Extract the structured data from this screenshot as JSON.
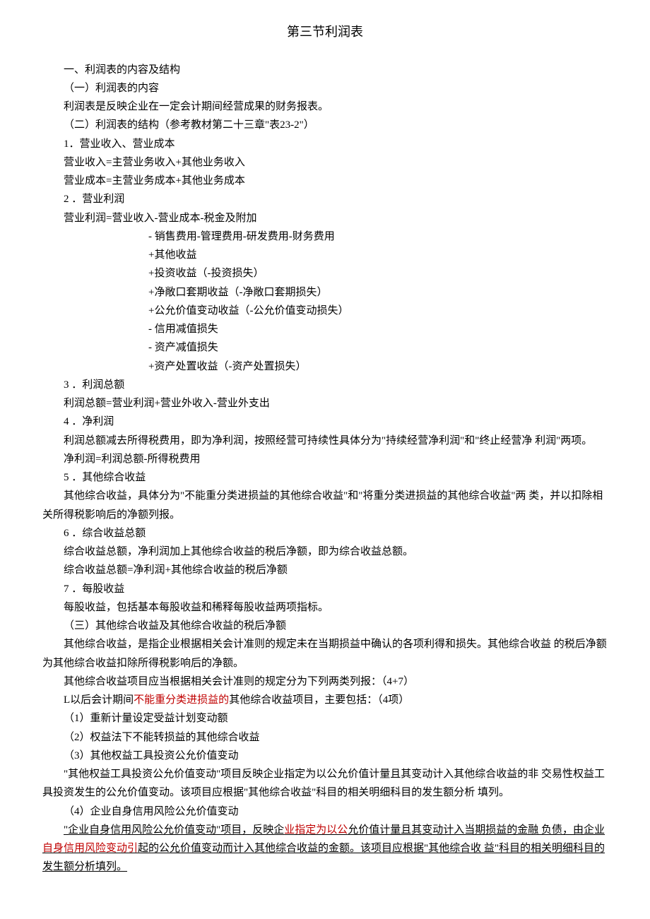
{
  "title": "第三节利润表",
  "lines": {
    "l1": "一、利润表的内容及结构",
    "l2": "（一）利润表的内容",
    "l3": "利润表是反映企业在一定会计期间经营成果的财务报表。",
    "l4": "（二）利润表的结构（参考教材第二十三章\"表23-2\"）",
    "l5": "1．营业收入、营业成本",
    "l6": "营业收入=主营业务收入+其他业务收入",
    "l7": "营业成本=主营业务成本+其他业务成本",
    "l8": "2 ．营业利润",
    "l9": "营业利润=营业收入-营业成本-税金及附加",
    "l10": "-  销售费用-管理费用-研发费用-财务费用",
    "l11": "+其他收益",
    "l12": "+投资收益（-投资损失）",
    "l13": "+净敞口套期收益（-净敞口套期损失）",
    "l14": "+公允价值变动收益（-公允价值变动损失）",
    "l15": "-  信用减值损失",
    "l16": "-  资产减值损失",
    "l17": "+资产处置收益（-资产处置损失）",
    "l18": "3 ．利润总额",
    "l19": "利润总额=营业利润+营业外收入-营业外支出",
    "l20": "4 ．净利润",
    "l21": "利润总额减去所得税费用，即为净利润，按照经营可持续性具体分为\"持续经营净利润\"和\"终止经营净  利润\"两项。",
    "l22": "净利润=利润总额-所得税费用",
    "l23": "5 ．其他综合收益",
    "l24": "其他综合收益，具体分为\"不能重分类进损益的其他综合收益\"和\"将重分类进损益的其他综合收益\"两  类，并以扣除相关所得税影响后的净额列报。",
    "l25": "6 ．综合收益总额",
    "l26": "综合收益总额，净利润加上其他综合收益的税后净额，即为综合收益总额。",
    "l27": "综合收益总额=净利润+其他综合收益的税后净额",
    "l28": "7 ．每股收益",
    "l29": "每股收益，包括基本每股收益和稀释每股收益两项指标。",
    "l30": "（三）其他综合收益及其他综合收益的税后净额",
    "l31": "其他综合收益，是指企业根据相关会计准则的规定未在当期损益中确认的各项利得和损失。其他综合收益  的税后净额为其他综合收益扣除所得税影响后的净额。",
    "l32": "其他综合收益项目应当根据相关会计准则的规定分为下列两类列报：（4+7）",
    "l33a": "L以后会计期间",
    "l33b": "不能重分类进损益的",
    "l33c": "其他综合收益项目，主要包括：（4项）",
    "l34": "（1）重新计量设定受益计划变动额",
    "l35": "（2）权益法下不能转损益的其他综合收益",
    "l36": "（3）其他权益工具投资公允价值变动",
    "l37": "\"其他权益工具投资公允价值变动\"项目反映企业指定为以公允价值计量且其变动计入其他综合收益的非  交易性权益工具投资发生的公允价值变动。该项目应根据\"其他综合收益\"科目的相关明细科目的发生额分析  填列。",
    "l38": "（4）企业自身信用风险公允价值变动",
    "l39a": "\"企业自身信用风险公允价值变动\"项目，反映企",
    "l39b": "业指定为以公",
    "l39c": "允价值计量且其变动计入当期损益的金融  负债，由企业",
    "l39d": "自身信用风险变动引",
    "l39e": "起的公允价值变动而计入其他综合收益的金额。该项目应根据\"其他综合收  益\"科目的相关明细科目的发生额分析填列。"
  }
}
